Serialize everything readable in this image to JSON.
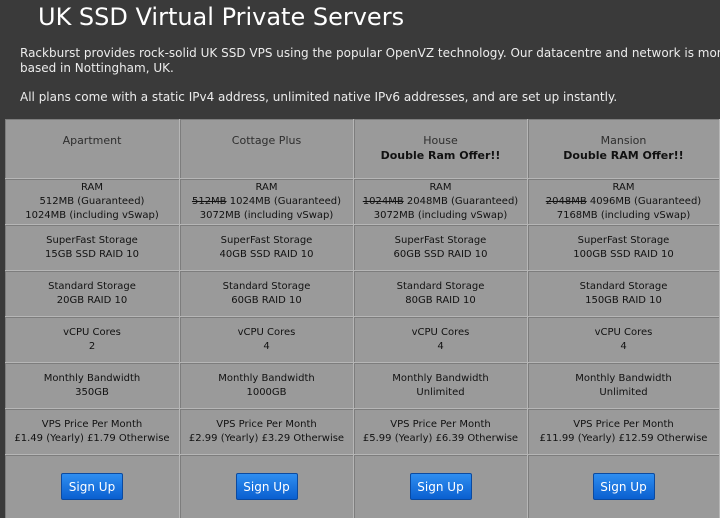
{
  "page": {
    "title": "UK SSD Virtual Private Servers",
    "intro_line1": "Rackburst provides rock-solid UK SSD VPS using the popular OpenVZ technology. Our datacentre and network is monit",
    "intro_line2": "based in Nottingham, UK.",
    "intro_line3": "All plans come with a static IPv4 address, unlimited native IPv6 addresses, and are set up instantly."
  },
  "plans": [
    {
      "name": "Apartment",
      "offer": "",
      "ram_label": "RAM",
      "ram_old": "",
      "ram_guaranteed": "512MB (Guaranteed)",
      "ram_vswap": "1024MB (including vSwap)",
      "storage_label": "SuperFast Storage",
      "storage_value": "15GB SSD RAID 10",
      "std_storage_label": "Standard Storage",
      "std_storage_value": "20GB RAID 10",
      "cpu_label": "vCPU Cores",
      "cpu_value": "2",
      "bandwidth_label": "Monthly Bandwidth",
      "bandwidth_value": "350GB",
      "price_label": "VPS Price Per Month",
      "price_value": "£1.49 (Yearly) £1.79 Otherwise",
      "signup_label": "Sign Up"
    },
    {
      "name": "Cottage Plus",
      "offer": "",
      "ram_label": "RAM",
      "ram_old": "512MB",
      "ram_guaranteed": "1024MB (Guaranteed)",
      "ram_vswap": "3072MB (including vSwap)",
      "storage_label": "SuperFast Storage",
      "storage_value": "40GB SSD RAID 10",
      "std_storage_label": "Standard Storage",
      "std_storage_value": "60GB RAID 10",
      "cpu_label": "vCPU Cores",
      "cpu_value": "4",
      "bandwidth_label": "Monthly Bandwidth",
      "bandwidth_value": "1000GB",
      "price_label": "VPS Price Per Month",
      "price_value": "£2.99 (Yearly) £3.29 Otherwise",
      "signup_label": "Sign Up"
    },
    {
      "name": "House",
      "offer": "Double Ram Offer!!",
      "ram_label": "RAM",
      "ram_old": "1024MB",
      "ram_guaranteed": "2048MB (Guaranteed)",
      "ram_vswap": "3072MB (including vSwap)",
      "storage_label": "SuperFast Storage",
      "storage_value": "60GB SSD RAID 10",
      "std_storage_label": "Standard Storage",
      "std_storage_value": "80GB RAID 10",
      "cpu_label": "vCPU Cores",
      "cpu_value": "4",
      "bandwidth_label": "Monthly Bandwidth",
      "bandwidth_value": "Unlimited",
      "price_label": "VPS Price Per Month",
      "price_value": "£5.99 (Yearly) £6.39 Otherwise",
      "signup_label": "Sign Up"
    },
    {
      "name": "Mansion",
      "offer": "Double RAM Offer!!",
      "ram_label": "RAM",
      "ram_old": "2048MB",
      "ram_guaranteed": "4096MB (Guaranteed)",
      "ram_vswap": "7168MB (including vSwap)",
      "storage_label": "SuperFast Storage",
      "storage_value": "100GB SSD RAID 10",
      "std_storage_label": "Standard Storage",
      "std_storage_value": "150GB RAID 10",
      "cpu_label": "vCPU Cores",
      "cpu_value": "4",
      "bandwidth_label": "Monthly Bandwidth",
      "bandwidth_value": "Unlimited",
      "price_label": "VPS Price Per Month",
      "price_value": "£11.99 (Yearly) £12.59 Otherwise",
      "signup_label": "Sign Up"
    }
  ],
  "colors": {
    "background": "#3a3a3a",
    "table_cell": "#9a9a9a",
    "button": "#1a75e0"
  }
}
